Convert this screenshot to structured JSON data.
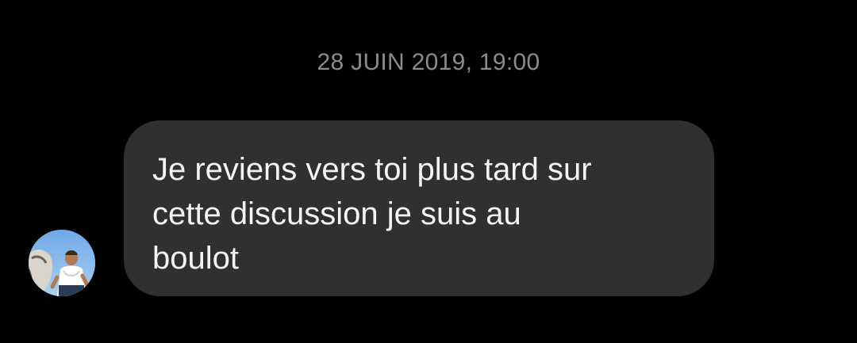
{
  "conversation": {
    "timestamp": "28 JUIN 2019, 19:00",
    "messages": [
      {
        "direction": "incoming",
        "avatar": "contact-avatar-photo",
        "text": "Je reviens vers toi plus tard sur\ncette discussion je suis au\nboulot"
      }
    ]
  },
  "colors": {
    "background": "#000000",
    "bubble": "#303030",
    "bubble_text": "#f4f4f4",
    "timestamp_text": "#8c8c8c",
    "avatar_sky": "#7fb6ea"
  }
}
